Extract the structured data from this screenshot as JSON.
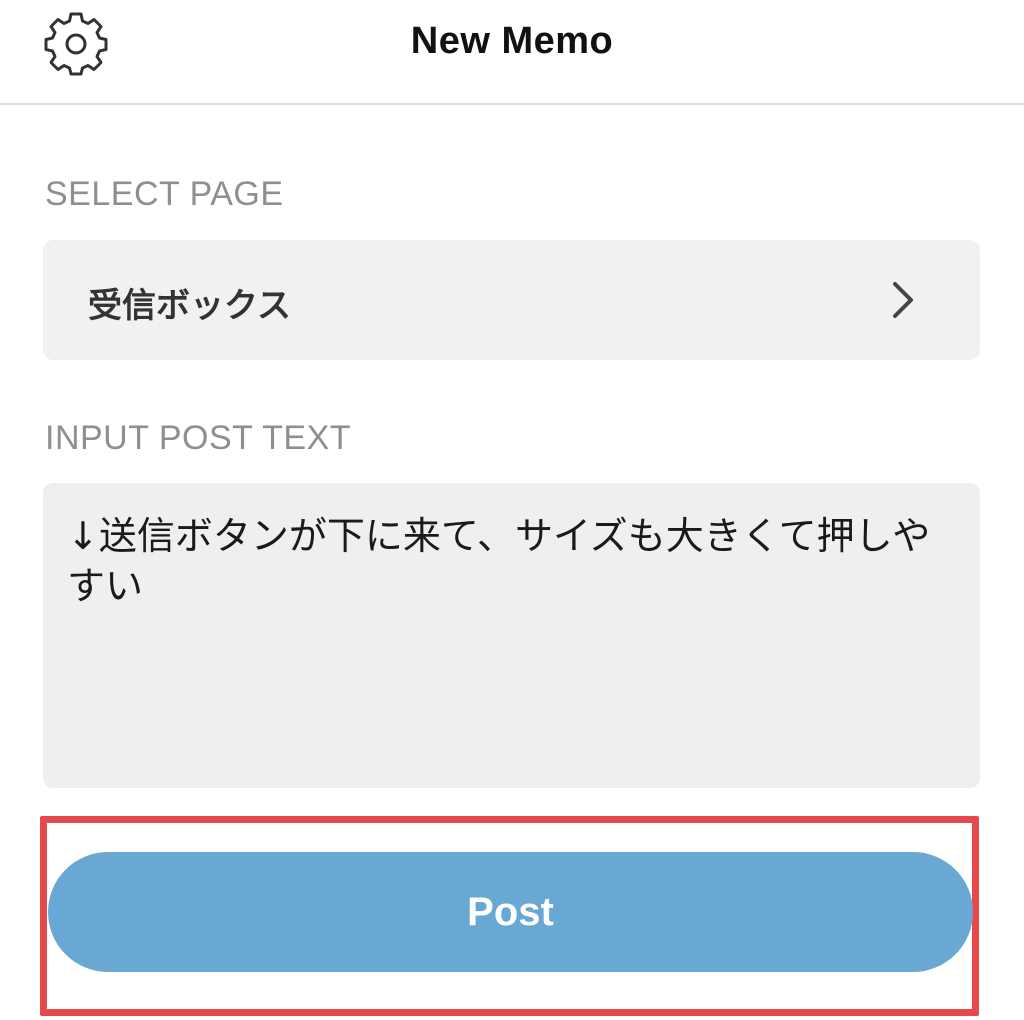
{
  "header": {
    "title": "New Memo",
    "settings_icon": "gear-icon"
  },
  "select_page": {
    "label": "SELECT PAGE",
    "selected_value": "受信ボックス",
    "icon": "chevron-right-icon"
  },
  "post_text": {
    "label": "INPUT POST TEXT",
    "value": "↓送信ボタンが下に来て、サイズも大きくて押しやすい"
  },
  "post_button": {
    "label": "Post"
  },
  "colors": {
    "button": "#69a8d3",
    "highlight": "#e5484d",
    "field_background": "#f1f1f1",
    "label_gray": "#8e8e93"
  }
}
